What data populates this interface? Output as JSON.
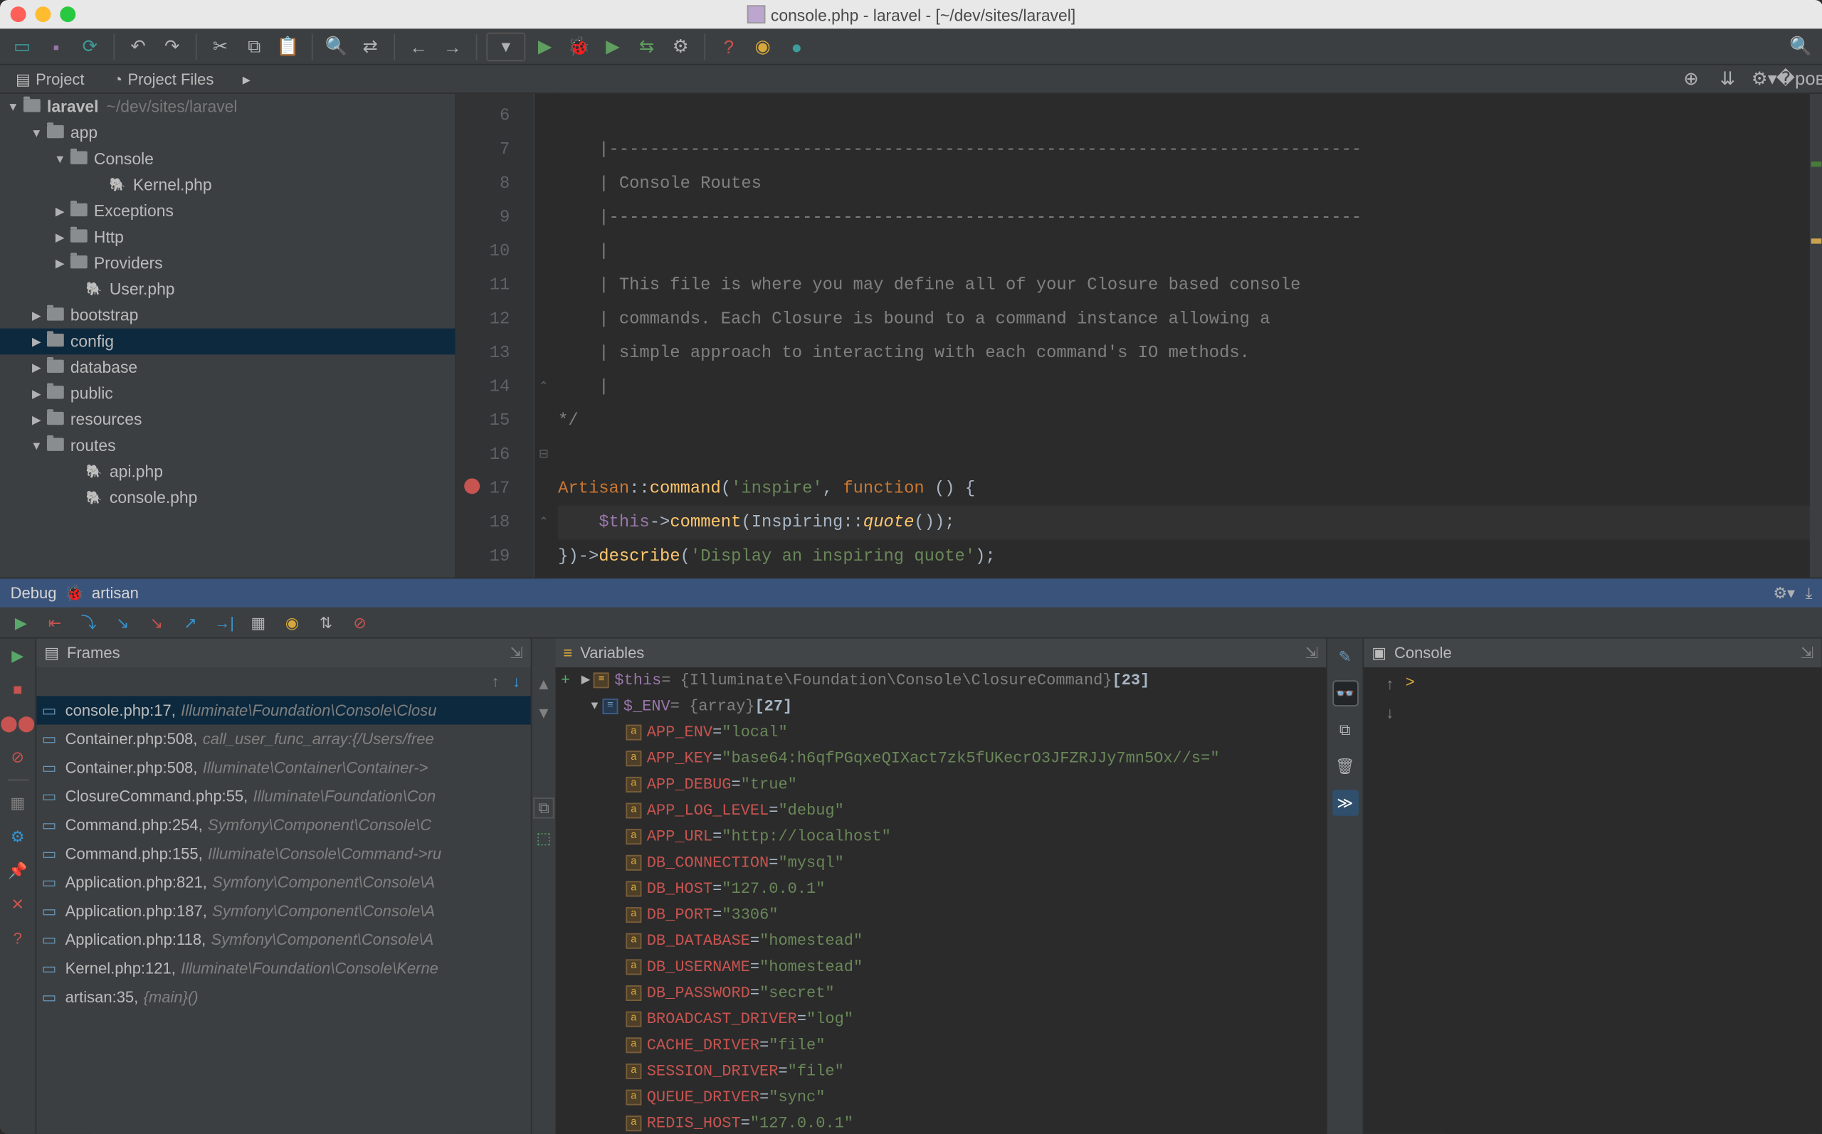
{
  "title": "console.php - laravel - [~/dev/sites/laravel]",
  "tabs": {
    "project": "Project",
    "project_files": "Project Files"
  },
  "tree": {
    "root": "laravel",
    "root_path": "~/dev/sites/laravel",
    "app": "app",
    "console": "Console",
    "kernel": "Kernel.php",
    "exceptions": "Exceptions",
    "http": "Http",
    "providers": "Providers",
    "user": "User.php",
    "bootstrap": "bootstrap",
    "config": "config",
    "database": "database",
    "public": "public",
    "resources": "resources",
    "routes": "routes",
    "api": "api.php",
    "consolephp": "console.php"
  },
  "editor": {
    "lines": {
      "6": "    |--------------------------------------------------------------------------",
      "7": "    | Console Routes",
      "8": "    |--------------------------------------------------------------------------",
      "9": "    |",
      "10": "    | This file is where you may define all of your Closure based console",
      "11": "    | commands. Each Closure is bound to a command instance allowing a",
      "12": "    | simple approach to interacting with each command's IO methods.",
      "13": "    |",
      "14": "*/",
      "15": "",
      "19": ""
    },
    "l16": {
      "a": "Artisan",
      "b": "::",
      "c": "command",
      "d": "(",
      "e": "'inspire'",
      "f": ", ",
      "g": "function",
      "h": " () {"
    },
    "l17": {
      "a": "    $this",
      "b": "->",
      "c": "comment",
      "d": "(",
      "e": "Inspiring",
      "f": "::",
      "g": "quote",
      "h": "());"
    },
    "l18": {
      "a": "})->",
      "b": "describe",
      "c": "(",
      "d": "'Display an inspiring quote'",
      "e": ");"
    }
  },
  "debug": {
    "label": "Debug",
    "session": "artisan",
    "frames_label": "Frames",
    "vars_label": "Variables",
    "console_label": "Console",
    "console_prompt": ">",
    "frames": [
      {
        "f": "console.php:17, ",
        "c": "Illuminate\\Foundation\\Console\\Closu"
      },
      {
        "f": "Container.php:508, ",
        "c": "call_user_func_array:{/Users/free"
      },
      {
        "f": "Container.php:508, ",
        "c": "Illuminate\\Container\\Container->"
      },
      {
        "f": "ClosureCommand.php:55, ",
        "c": "Illuminate\\Foundation\\Con"
      },
      {
        "f": "Command.php:254, ",
        "c": "Symfony\\Component\\Console\\C"
      },
      {
        "f": "Command.php:155, ",
        "c": "Illuminate\\Console\\Command->ru"
      },
      {
        "f": "Application.php:821, ",
        "c": "Symfony\\Component\\Console\\A"
      },
      {
        "f": "Application.php:187, ",
        "c": "Symfony\\Component\\Console\\A"
      },
      {
        "f": "Application.php:118, ",
        "c": "Symfony\\Component\\Console\\A"
      },
      {
        "f": "Kernel.php:121, ",
        "c": "Illuminate\\Foundation\\Console\\Kerne"
      },
      {
        "f": "artisan:35, ",
        "c": "{main}()"
      }
    ],
    "vars": {
      "this_name": "$this",
      "this_val": " = {Illuminate\\Foundation\\Console\\ClosureCommand} ",
      "this_count": "[23]",
      "env_name": "$_ENV",
      "env_val": " = {array} ",
      "env_count": "[27]",
      "items": [
        {
          "k": "APP_ENV",
          "v": "\"local\""
        },
        {
          "k": "APP_KEY",
          "v": "\"base64:h6qfPGqxeQIXact7zk5fUKecrO3JFZRJJy7mn5Ox//s=\""
        },
        {
          "k": "APP_DEBUG",
          "v": "\"true\""
        },
        {
          "k": "APP_LOG_LEVEL",
          "v": "\"debug\""
        },
        {
          "k": "APP_URL",
          "v": "\"http://localhost\""
        },
        {
          "k": "DB_CONNECTION",
          "v": "\"mysql\""
        },
        {
          "k": "DB_HOST",
          "v": "\"127.0.0.1\""
        },
        {
          "k": "DB_PORT",
          "v": "\"3306\""
        },
        {
          "k": "DB_DATABASE",
          "v": "\"homestead\""
        },
        {
          "k": "DB_USERNAME",
          "v": "\"homestead\""
        },
        {
          "k": "DB_PASSWORD",
          "v": "\"secret\""
        },
        {
          "k": "BROADCAST_DRIVER",
          "v": "\"log\""
        },
        {
          "k": "CACHE_DRIVER",
          "v": "\"file\""
        },
        {
          "k": "SESSION_DRIVER",
          "v": "\"file\""
        },
        {
          "k": "QUEUE_DRIVER",
          "v": "\"sync\""
        },
        {
          "k": "REDIS_HOST",
          "v": "\"127.0.0.1\""
        }
      ]
    }
  }
}
